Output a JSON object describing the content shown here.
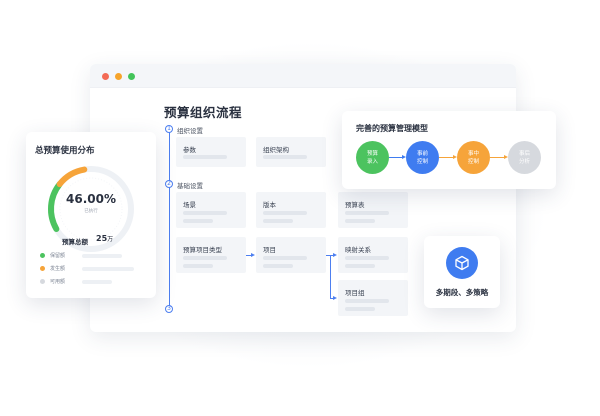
{
  "window": {
    "title": "预算组织流程"
  },
  "steps": [
    {
      "num": "1",
      "label": "组织设置"
    },
    {
      "num": "2",
      "label": "基础设置"
    },
    {
      "num": "3",
      "label": ""
    }
  ],
  "nodes": {
    "params": "参数",
    "org_structure": "组织架构",
    "scene": "场景",
    "version": "版本",
    "budget_table": "预算表",
    "budget_item_type": "预算项目类型",
    "item": "项目",
    "mapping": "映射关系",
    "item_group": "项目组"
  },
  "budget_card": {
    "title": "总预算使用分布",
    "percent": "46.00%",
    "percent_value": 46.0,
    "sub_label": "已执行",
    "total_label": "预算总额",
    "total_value": "25",
    "total_unit": "万",
    "legend": [
      {
        "label": "保留额",
        "color": "#4cc35f"
      },
      {
        "label": "发生额",
        "color": "#f6a43a"
      },
      {
        "label": "可用额",
        "color": "#d6d9de"
      }
    ]
  },
  "model_card": {
    "title": "完善的预算管理模型",
    "stages": [
      {
        "line1": "预算",
        "line2": "录入",
        "color": "#4cc35f"
      },
      {
        "line1": "事前",
        "line2": "控制",
        "color": "#3f7cf0"
      },
      {
        "line1": "事中",
        "line2": "控制",
        "color": "#f6a43a"
      },
      {
        "line1": "事后",
        "line2": "分析",
        "color": "#d6d9de"
      }
    ]
  },
  "multi_card": {
    "label": "多期段、多策略",
    "icon": "cube-icon"
  },
  "colors": {
    "accent": "#4d7ff0",
    "green": "#4cc35f",
    "orange": "#f6a43a",
    "gray": "#d6d9de"
  }
}
